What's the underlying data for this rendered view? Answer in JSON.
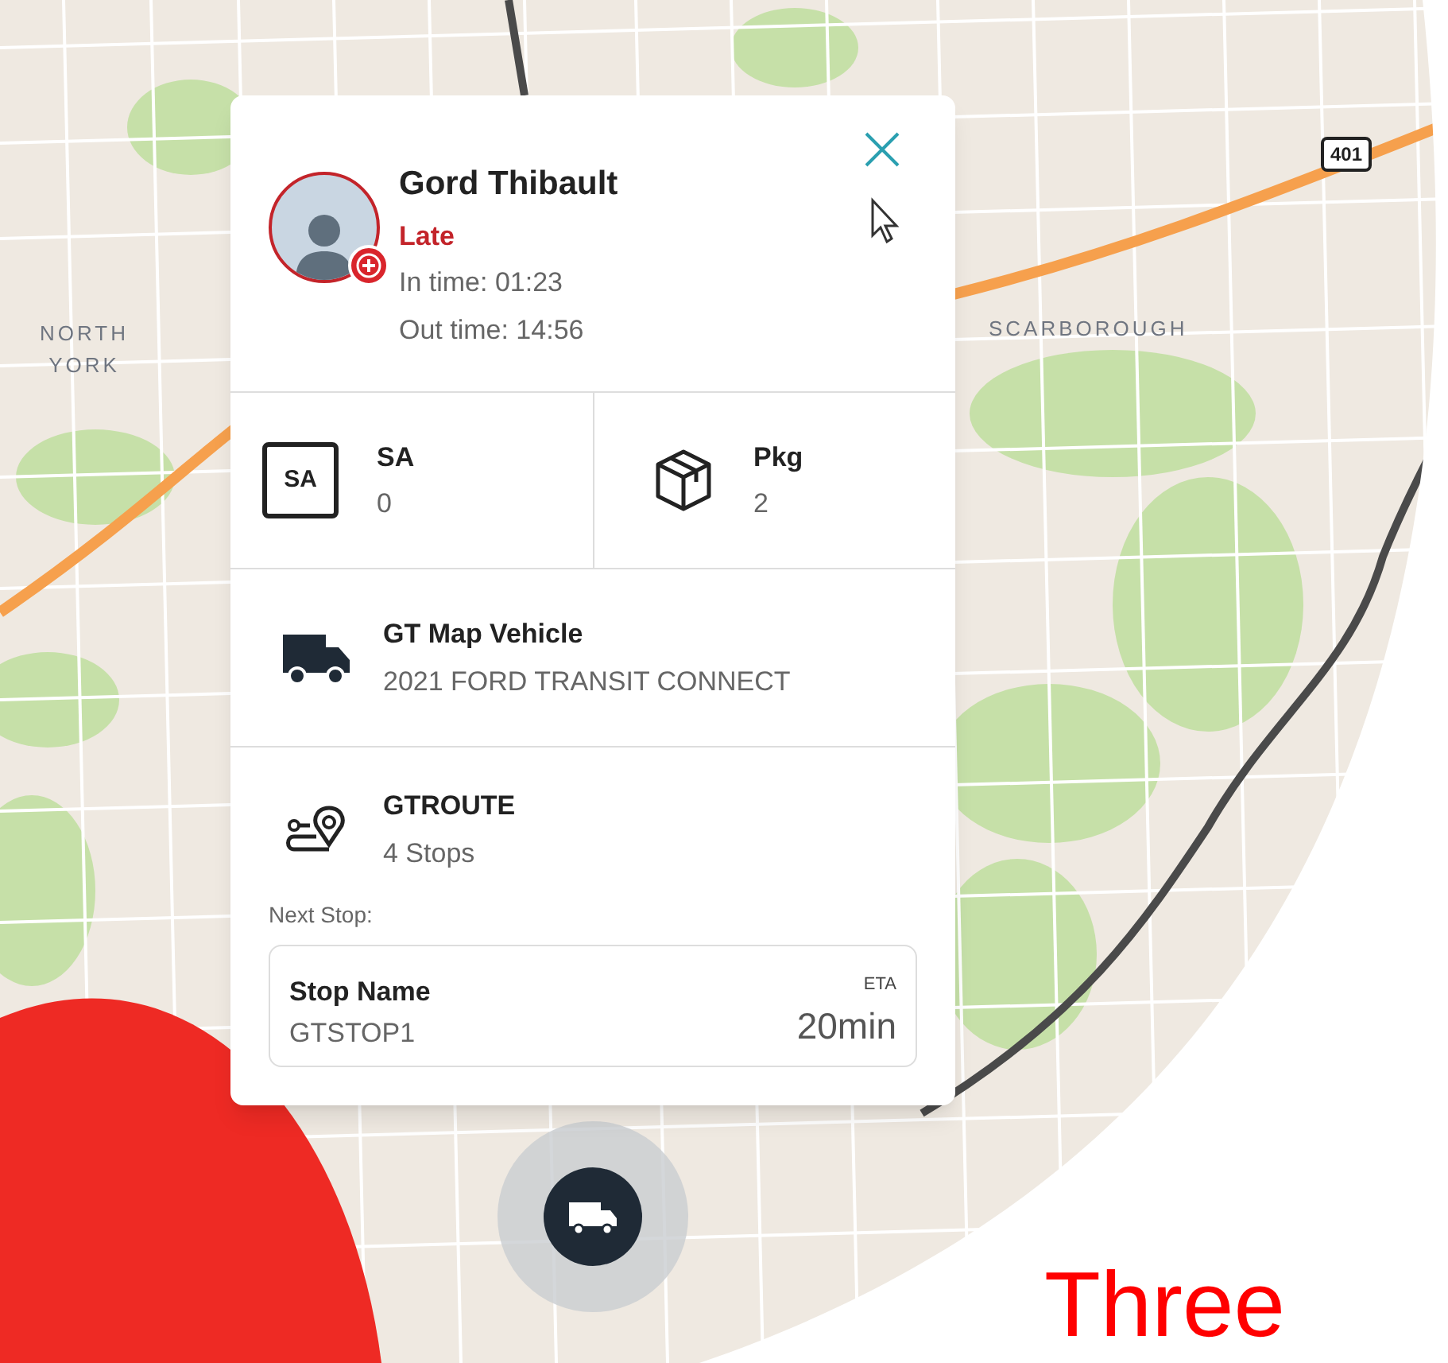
{
  "map": {
    "labels": [
      {
        "text": "NORTH YORK",
        "kind": "west"
      },
      {
        "text": "SCARBOROUGH",
        "kind": "east"
      }
    ],
    "highway_shield": "401"
  },
  "driver_card": {
    "name": "Gord Thibault",
    "status": "Late",
    "in_time": "In time: 01:23",
    "out_time": "Out time: 14:56",
    "stats": [
      {
        "kind": "sa",
        "icon_text": "SA",
        "label": "SA",
        "value": "0"
      },
      {
        "kind": "package",
        "label": "Pkg",
        "value": "2"
      }
    ],
    "vehicle": {
      "name": "GT Map Vehicle",
      "model": "2021 FORD TRANSIT CONNECT"
    },
    "route": {
      "name": "GTROUTE",
      "stops": "4 Stops"
    },
    "next_stop": {
      "label": "Next Stop:",
      "title": "Stop Name",
      "name": "GTSTOP1",
      "eta_label": "ETA",
      "eta": "20min"
    }
  },
  "headline": "Three"
}
